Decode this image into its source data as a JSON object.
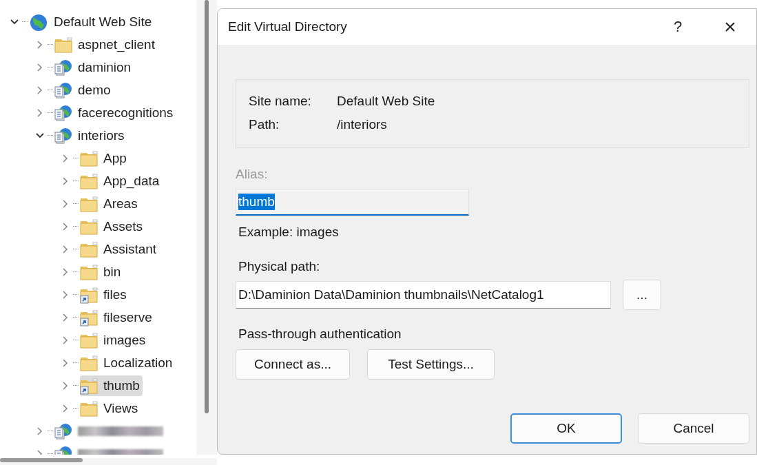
{
  "tree": [
    {
      "label": "Default Web Site",
      "kind": "site",
      "expanded": true,
      "selected": false,
      "children": [
        {
          "label": "aspnet_client",
          "kind": "folder",
          "expanded": false,
          "selected": false
        },
        {
          "label": "daminion",
          "kind": "app",
          "expanded": false,
          "selected": false
        },
        {
          "label": "demo",
          "kind": "app",
          "expanded": false,
          "selected": false
        },
        {
          "label": "facerecognitions",
          "kind": "app",
          "expanded": false,
          "selected": false
        },
        {
          "label": "interiors",
          "kind": "app",
          "expanded": true,
          "selected": false,
          "children": [
            {
              "label": "App",
              "kind": "folder",
              "expanded": false,
              "selected": false
            },
            {
              "label": "App_data",
              "kind": "folder",
              "expanded": false,
              "selected": false
            },
            {
              "label": "Areas",
              "kind": "folder",
              "expanded": false,
              "selected": false
            },
            {
              "label": "Assets",
              "kind": "folder",
              "expanded": false,
              "selected": false
            },
            {
              "label": "Assistant",
              "kind": "folder",
              "expanded": false,
              "selected": false
            },
            {
              "label": "bin",
              "kind": "folder",
              "expanded": false,
              "selected": false
            },
            {
              "label": "files",
              "kind": "vdir",
              "expanded": false,
              "selected": false
            },
            {
              "label": "fileserve",
              "kind": "vdir",
              "expanded": false,
              "selected": false
            },
            {
              "label": "images",
              "kind": "folder",
              "expanded": false,
              "selected": false
            },
            {
              "label": "Localization",
              "kind": "folder",
              "expanded": false,
              "selected": false
            },
            {
              "label": "thumb",
              "kind": "vdir",
              "expanded": false,
              "selected": true
            },
            {
              "label": "Views",
              "kind": "folder",
              "expanded": false,
              "selected": false
            }
          ]
        },
        {
          "kind": "app",
          "blurred": true,
          "expanded": false,
          "selected": false
        },
        {
          "kind": "app",
          "blurred": true,
          "expanded": false,
          "selected": false
        }
      ]
    }
  ],
  "dialog": {
    "title": "Edit Virtual Directory",
    "help": "?",
    "close": "×",
    "info": [
      {
        "label": "Site name:",
        "value": "Default Web Site"
      },
      {
        "label": "Path:",
        "value": "/interiors"
      }
    ],
    "alias": {
      "label": "Alias:",
      "label_disabled": true,
      "value": "thumb",
      "value_selected": true
    },
    "example": "Example: images",
    "physical_path": {
      "label": "Physical path:",
      "value": "D:\\Daminion Data\\Daminion thumbnails\\NetCatalog1",
      "browse": "..."
    },
    "auth_label": "Pass-through authentication",
    "auth_buttons": [
      "Connect as...",
      "Test Settings..."
    ],
    "buttons": [
      {
        "label": "OK",
        "default": true
      },
      {
        "label": "Cancel",
        "default": false
      }
    ]
  }
}
